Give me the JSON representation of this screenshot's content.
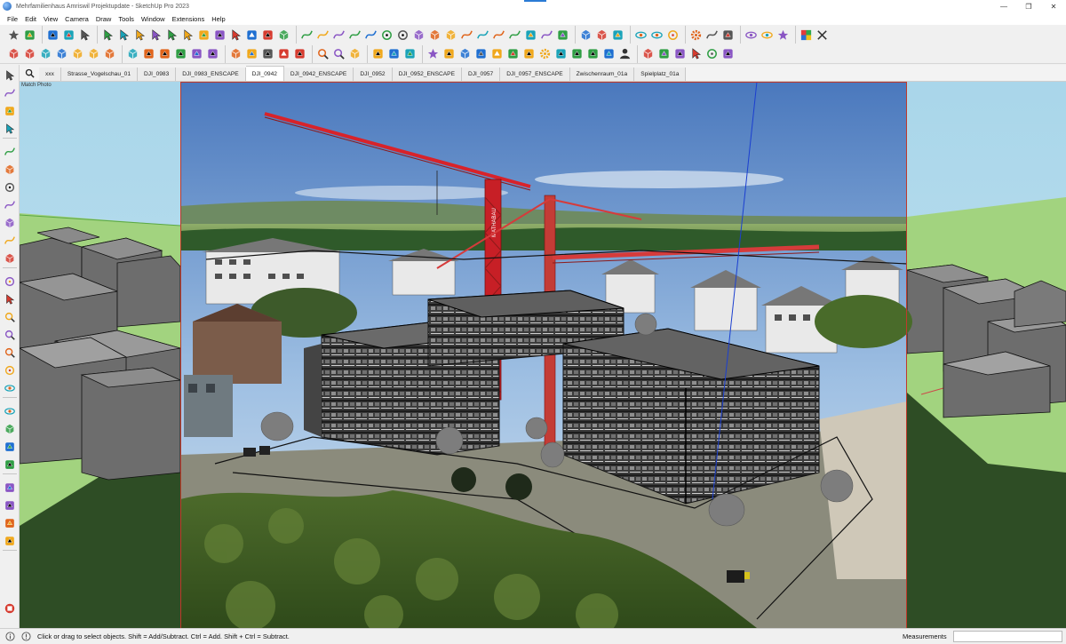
{
  "window": {
    "title": "Mehrfamilienhaus Amriswil Projektupdate - SketchUp Pro 2023",
    "minimize_glyph": "—",
    "maximize_glyph": "❐",
    "close_glyph": "✕"
  },
  "menu": [
    "File",
    "Edit",
    "View",
    "Camera",
    "Draw",
    "Tools",
    "Window",
    "Extensions",
    "Help"
  ],
  "toolbar_row1_groups": [
    {
      "icons": [
        "getting-started-icon",
        "eraser-icon"
      ]
    },
    {
      "icons": [
        "make-component-icon",
        "paint-bucket-icon",
        "push-pull-icon"
      ]
    },
    {
      "icons": [
        "select-icon",
        "move-icon",
        "rotate-icon",
        "scale-icon",
        "follow-me-icon",
        "offset-icon",
        "tape-measure-icon",
        "protractor-icon",
        "axes-icon",
        "dimension-icon",
        "text-icon",
        "section-plane-icon"
      ]
    },
    {
      "icons": [
        "line-icon",
        "freehand-icon",
        "arc-icon",
        "two-point-arc-icon",
        "three-point-arc-icon",
        "pie-icon",
        "circle-icon",
        "polygon-icon",
        "rectangle-icon",
        "rotated-rectangle-icon",
        "curve-icon",
        "spline-icon",
        "bezier-icon",
        "join-curve-icon",
        "wrench-icon",
        "curve-loop-icon",
        "flatten-icon"
      ]
    },
    {
      "icons": [
        "sandbox-from-contours-icon",
        "sandbox-from-scratch-icon",
        "smoove-icon"
      ]
    },
    {
      "icons": [
        "walk-icon",
        "position-camera-icon",
        "look-around-icon"
      ]
    },
    {
      "icons": [
        "gear-icon",
        "outliner-icon",
        "component-browser-icon"
      ]
    },
    {
      "icons": [
        "hide-icon",
        "unhide-icon",
        "star-icon"
      ]
    },
    {
      "icons": [
        "color-by-layer-icon",
        "close-icon"
      ]
    }
  ],
  "toolbar_row2_groups": [
    {
      "icons": [
        "iso-view-icon",
        "top-view-icon",
        "front-view-icon",
        "right-view-icon",
        "back-view-icon",
        "left-view-icon",
        "bottom-view-icon"
      ]
    },
    {
      "icons": [
        "solid-tools-icon",
        "intersect-icon",
        "union-icon",
        "subtract-icon",
        "trim-icon",
        "split-icon"
      ]
    },
    {
      "icons": [
        "sandbox-smoove-icon",
        "stamp-icon",
        "drape-icon",
        "add-detail-icon",
        "flip-edge-icon"
      ]
    },
    {
      "icons": [
        "zoom-extents-icon",
        "zoom-window-icon",
        "previous-view-icon"
      ]
    },
    {
      "icons": [
        "shadows-icon",
        "fog-icon",
        "style-icon"
      ]
    },
    {
      "icons": [
        "enscape-start-icon",
        "enscape-sync-icon",
        "enscape-views-icon",
        "enscape-capture-icon",
        "enscape-video-icon",
        "enscape-materials-icon",
        "enscape-assets-icon",
        "enscape-settings-icon",
        "enscape-upload-icon",
        "enscape-vr-icon",
        "enscape-export-icon",
        "enscape-info-icon",
        "user-icon"
      ]
    },
    {
      "icons": [
        "sandbox-tools-icon",
        "curviloft-icon",
        "vertex-tools-icon",
        "joint-push-pull-icon",
        "round-corner-icon",
        "fredo-tools-icon"
      ]
    }
  ],
  "left_toolbar_icons": [
    "select-arrow-icon",
    "lasso-icon",
    "tape-measure-icon",
    "axis-icon",
    "line-icon",
    "rectangle-icon",
    "circle-icon",
    "arc-icon",
    "polygon-icon",
    "freehand-icon",
    "section-icon",
    "orbit-icon",
    "pan-icon",
    "zoom-icon",
    "zoom-window-icon",
    "zoom-extents-icon",
    "look-around-icon",
    "walk-icon",
    "position-camera-icon",
    "section-plane-icon",
    "components-icon",
    "materials-icon",
    "styles-icon",
    "layers-icon",
    "scenes-icon",
    "shadows-icon",
    "sketchup-logo-icon"
  ],
  "scene_tabs": [
    {
      "label": "xxx",
      "active": false
    },
    {
      "label": "Strasse_Vogelschau_01",
      "active": false
    },
    {
      "label": "DJI_0983",
      "active": false
    },
    {
      "label": "DJI_0983_ENSCAPE",
      "active": false
    },
    {
      "label": "DJI_0942",
      "active": true
    },
    {
      "label": "DJI_0942_ENSCAPE",
      "active": false
    },
    {
      "label": "DJI_0952",
      "active": false
    },
    {
      "label": "DJI_0952_ENSCAPE",
      "active": false
    },
    {
      "label": "DJI_0957",
      "active": false
    },
    {
      "label": "DJI_0957_ENSCAPE",
      "active": false
    },
    {
      "label": "Zwischenraum_01a",
      "active": false
    },
    {
      "label": "Spielplatz_01a",
      "active": false
    }
  ],
  "viewport": {
    "match_photo_label": "Match Photo",
    "crane_sign": "MATHABAU"
  },
  "status": {
    "hint": "Click or drag to select objects. Shift = Add/Subtract. Ctrl = Add. Shift + Ctrl = Subtract.",
    "measurements_label": "Measurements",
    "measurements_value": ""
  },
  "colors": {
    "accent": "#2a7bd5",
    "photo_frame": "#c0392b",
    "crane_red": "#d8232a",
    "ground_green": "#9fd17e"
  }
}
